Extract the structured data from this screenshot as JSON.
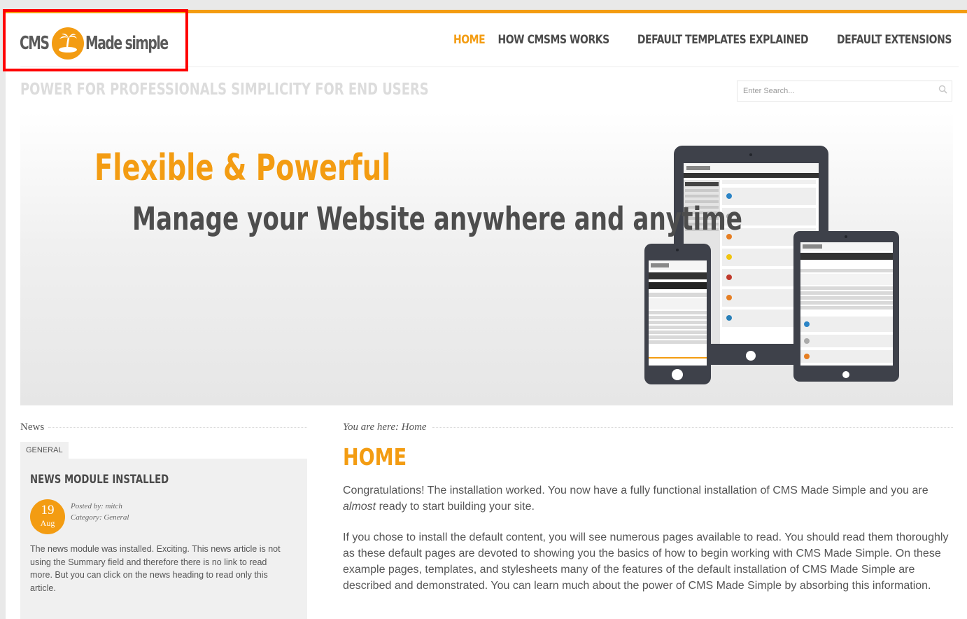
{
  "header": {
    "logo_text_cms": "CMS",
    "logo_text_made_simple": "Made simple",
    "nav": [
      "HOME",
      "HOW CMSMS WORKS",
      "DEFAULT TEMPLATES EXPLAINED",
      "DEFAULT EXTENSIONS"
    ],
    "active_nav": "HOME",
    "tagline": "POWER FOR PROFESSIONALS SIMPLICITY FOR END USERS",
    "search_placeholder": "Enter Search..."
  },
  "banner": {
    "headline": "Flexible & Powerful",
    "subheadline": "Manage your Website anywhere and anytime"
  },
  "sidebar": {
    "title": "News",
    "tab": "GENERAL",
    "article_title": "NEWS MODULE INSTALLED",
    "date_day": "19",
    "date_month": "Aug",
    "posted_by": "Posted by: mitch",
    "category": "Category: General",
    "body": "The news module was installed. Exciting. This news article is not using the Summary field and therefore there is no link to read more. But you can click on the news heading to read only this article."
  },
  "main": {
    "breadcrumb": "You are here: Home",
    "title": "HOME",
    "p1_before": "Congratulations! The installation worked. You now have a fully functional installation of CMS Made Simple and you are ",
    "p1_em": "almost",
    "p1_after": " ready to start building your site.",
    "p2": "If you chose to install the default content, you will see numerous pages available to read. You should read them thoroughly as these default pages are devoted to showing you the basics of how to begin working with CMS Made Simple. On these example pages, templates, and stylesheets many of the features of the default installation of CMS Made Simple are described and demonstrated. You can learn much about the power of CMS Made Simple by absorbing this information."
  },
  "colors": {
    "accent": "#f39c12",
    "highlight": "#ff0000",
    "text": "#555555"
  }
}
